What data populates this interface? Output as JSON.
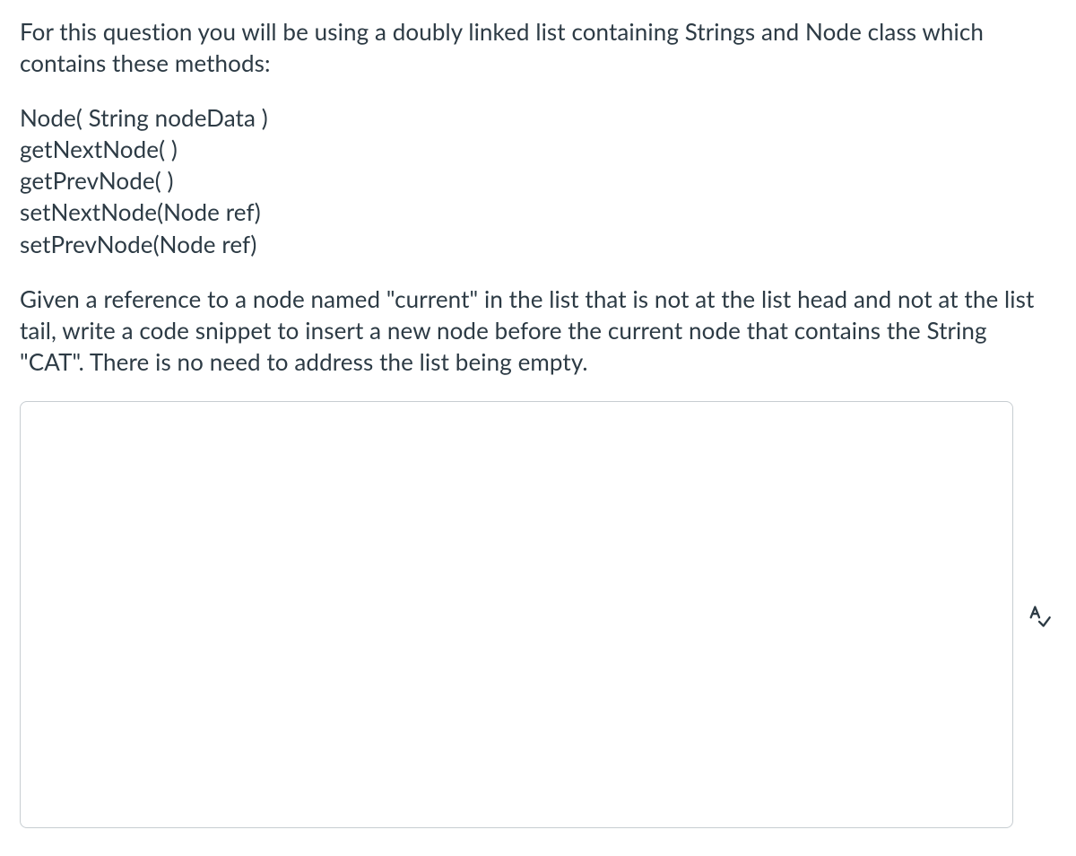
{
  "question": {
    "intro": "For this question you will be using a doubly linked list containing Strings and Node class which contains these methods:",
    "methods": [
      "Node( String nodeData )",
      "getNextNode( )",
      "getPrevNode( )",
      "setNextNode(Node ref)",
      "setPrevNode(Node ref)"
    ],
    "prompt": "Given a reference to a node named \"current\" in the list that is not at the list head and not at the list tail, write a code snippet to insert a new node before the current node that contains the String \"CAT\". There is no need to address the list being empty."
  },
  "answer": {
    "value": "",
    "placeholder": ""
  }
}
